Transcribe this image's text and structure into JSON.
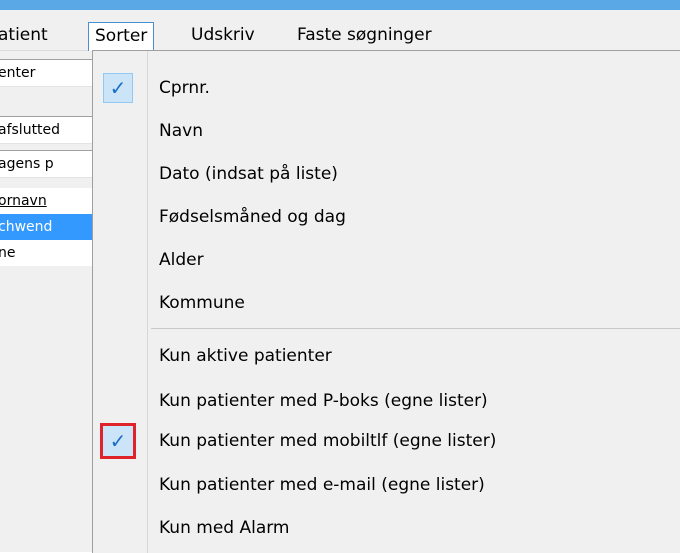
{
  "menubar": {
    "items": [
      {
        "label": "atient"
      },
      {
        "label": "Sorter"
      },
      {
        "label": "Udskriv"
      },
      {
        "label": "Faste søgninger"
      }
    ]
  },
  "left_panel": {
    "rows": [
      "enter",
      "afslutted",
      "agens p",
      "ornavn",
      "chwend",
      "ne"
    ]
  },
  "sort_menu": {
    "group1": [
      {
        "label": "Cprnr.",
        "checked": true
      },
      {
        "label": "Navn",
        "checked": false
      },
      {
        "label": "Dato (indsat på liste)",
        "checked": false
      },
      {
        "label": "Fødselsmåned og dag",
        "checked": false
      },
      {
        "label": "Alder",
        "checked": false
      },
      {
        "label": "Kommune",
        "checked": false
      }
    ],
    "group2": [
      {
        "label": "Kun aktive patienter",
        "checked": false
      },
      {
        "label": "Kun patienter med P-boks (egne lister)",
        "checked": false
      },
      {
        "label": "Kun patienter med mobiltlf (egne lister)",
        "checked": true
      },
      {
        "label": "Kun patienter med e-mail (egne lister)",
        "checked": false
      },
      {
        "label": "Kun med Alarm",
        "checked": false
      }
    ],
    "check_glyph": "✓"
  },
  "colors": {
    "accent": "#3399ff",
    "highlight_border": "#e0232a",
    "menu_background": "#f0f0f0",
    "top_strip": "#5aa9e6"
  }
}
